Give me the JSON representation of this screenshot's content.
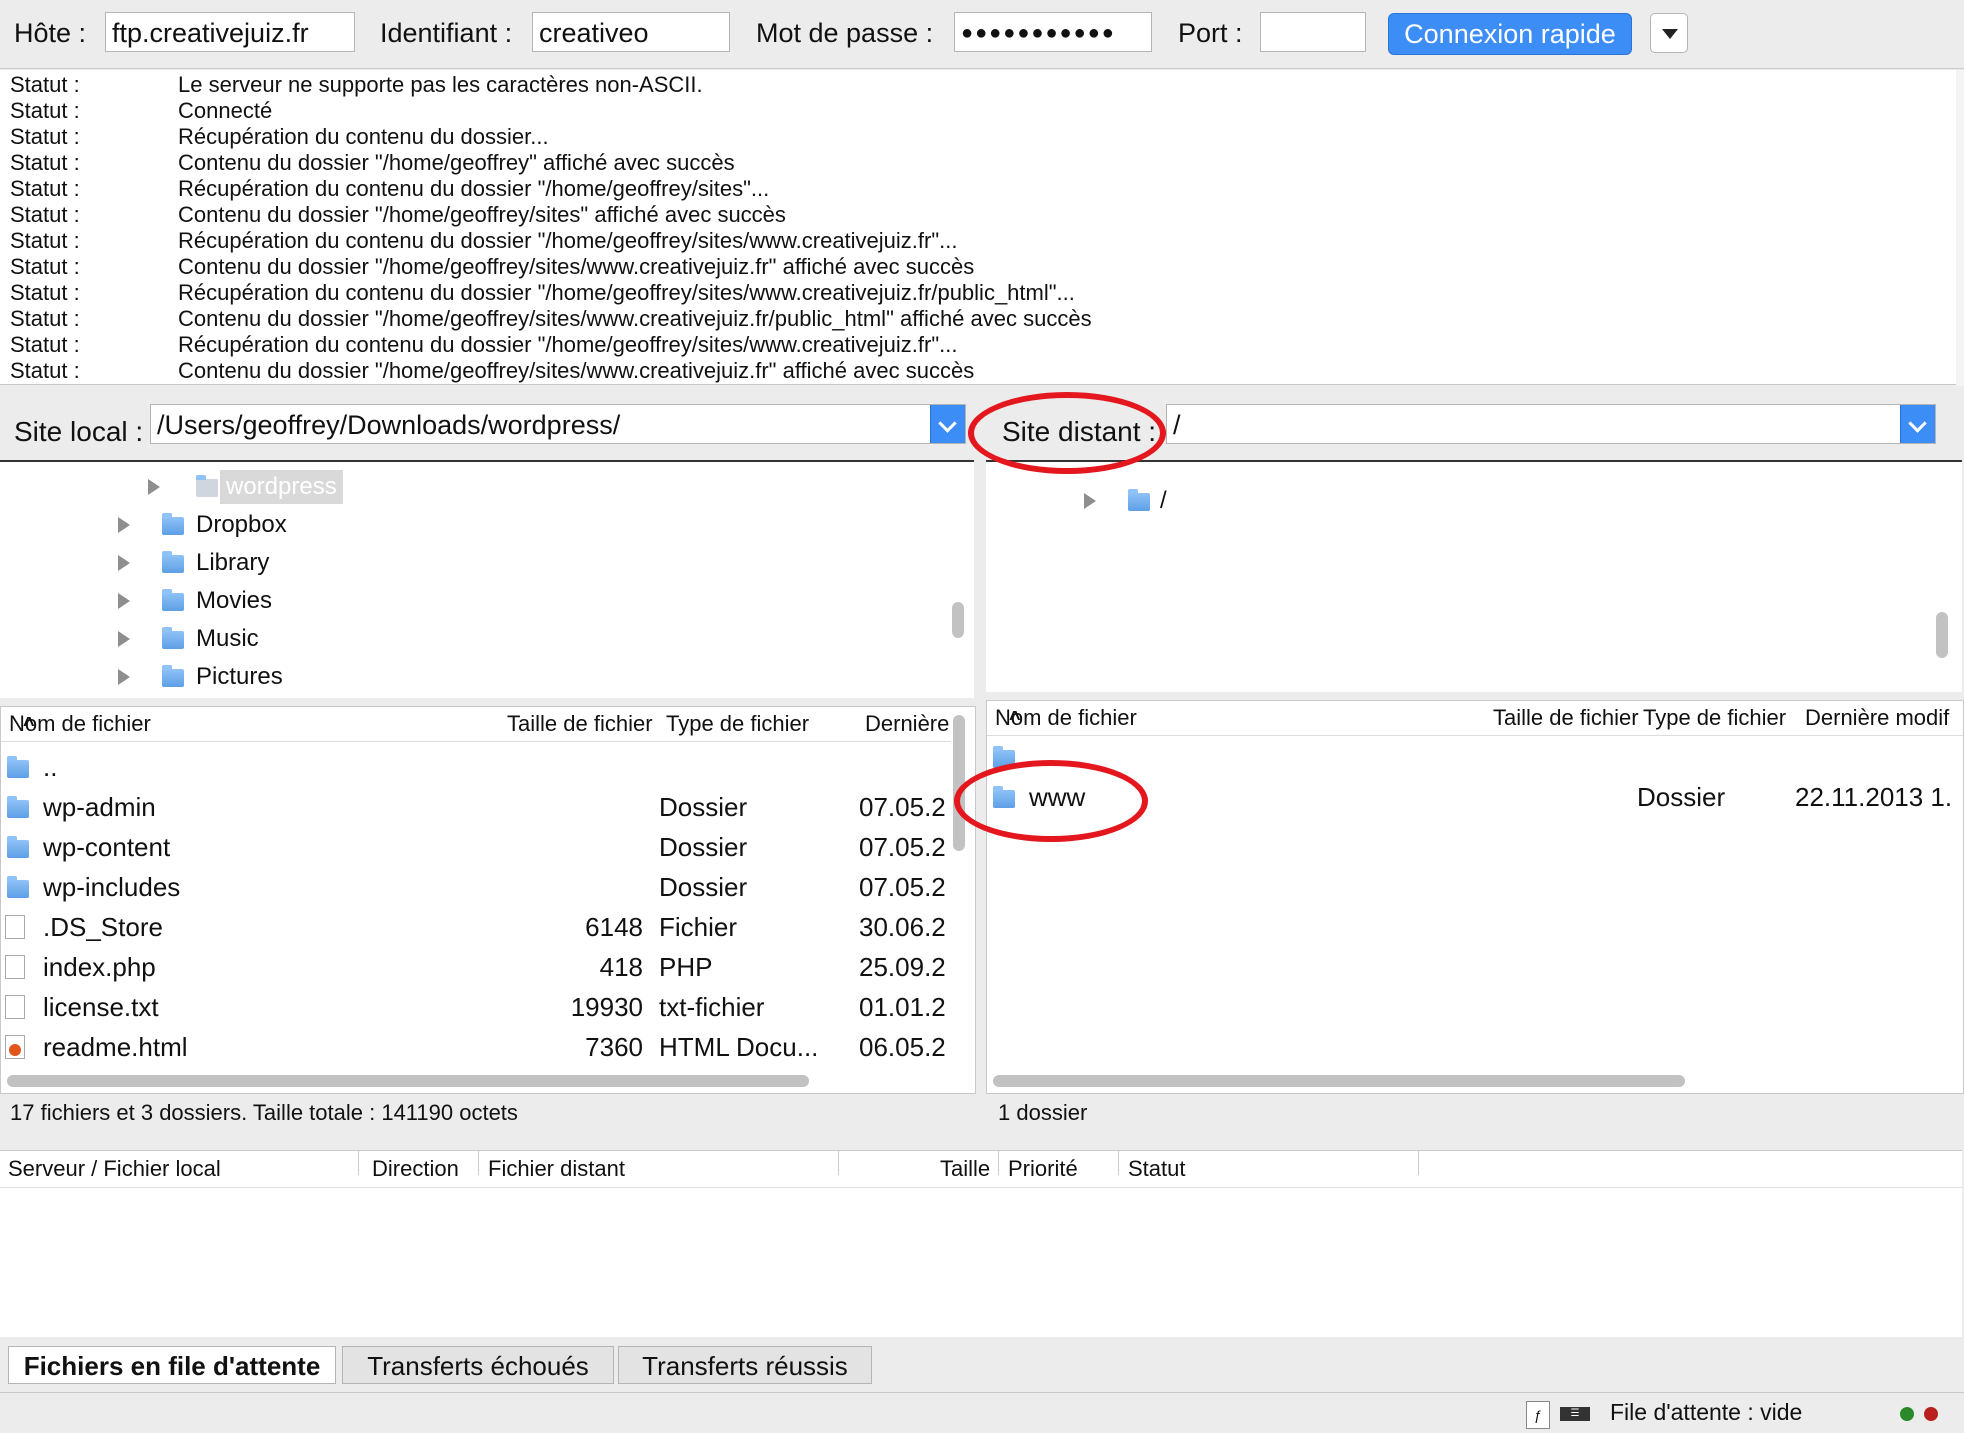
{
  "quickconnect": {
    "host_label": "Hôte :",
    "host_value": "ftp.creativejuiz.fr",
    "user_label": "Identifiant :",
    "user_value": "creativeo",
    "pass_label": "Mot de passe :",
    "pass_value": "●●●●●●●●●●●",
    "port_label": "Port :",
    "port_value": "",
    "connect_label": "Connexion rapide",
    "accent": "#3c8df6"
  },
  "log": [
    {
      "k": "Statut :",
      "v": "Le serveur ne supporte pas les caractères non-ASCII."
    },
    {
      "k": "Statut :",
      "v": "Connecté"
    },
    {
      "k": "Statut :",
      "v": "Récupération du contenu du dossier..."
    },
    {
      "k": "Statut :",
      "v": "Contenu du dossier \"/home/geoffrey\" affiché avec succès"
    },
    {
      "k": "Statut :",
      "v": "Récupération du contenu du dossier \"/home/geoffrey/sites\"..."
    },
    {
      "k": "Statut :",
      "v": "Contenu du dossier \"/home/geoffrey/sites\" affiché avec succès"
    },
    {
      "k": "Statut :",
      "v": "Récupération du contenu du dossier \"/home/geoffrey/sites/www.creativejuiz.fr\"..."
    },
    {
      "k": "Statut :",
      "v": "Contenu du dossier \"/home/geoffrey/sites/www.creativejuiz.fr\" affiché avec succès"
    },
    {
      "k": "Statut :",
      "v": "Récupération du contenu du dossier \"/home/geoffrey/sites/www.creativejuiz.fr/public_html\"..."
    },
    {
      "k": "Statut :",
      "v": "Contenu du dossier \"/home/geoffrey/sites/www.creativejuiz.fr/public_html\" affiché avec succès"
    },
    {
      "k": "Statut :",
      "v": "Récupération du contenu du dossier \"/home/geoffrey/sites/www.creativejuiz.fr\"..."
    },
    {
      "k": "Statut :",
      "v": "Contenu du dossier \"/home/geoffrey/sites/www.creativejuiz.fr\" affiché avec succès"
    }
  ],
  "local": {
    "label": "Site local :",
    "path": "/Users/geoffrey/Downloads/wordpress/",
    "tree": [
      "wordpress",
      "Dropbox",
      "Library",
      "Movies",
      "Music",
      "Pictures"
    ],
    "columns": {
      "name": "Nom de fichier",
      "size": "Taille de fichier",
      "type": "Type de fichier",
      "date": "Dernière"
    },
    "files": [
      {
        "name": "..",
        "size": "",
        "type": "",
        "date": "",
        "icon": "folder-icon"
      },
      {
        "name": "wp-admin",
        "size": "",
        "type": "Dossier",
        "date": "07.05.2",
        "icon": "folder-icon"
      },
      {
        "name": "wp-content",
        "size": "",
        "type": "Dossier",
        "date": "07.05.2",
        "icon": "folder-icon"
      },
      {
        "name": "wp-includes",
        "size": "",
        "type": "Dossier",
        "date": "07.05.2",
        "icon": "folder-icon"
      },
      {
        "name": ".DS_Store",
        "size": "6148",
        "type": "Fichier",
        "date": "30.06.2",
        "icon": "file-icon"
      },
      {
        "name": "index.php",
        "size": "418",
        "type": "PHP",
        "date": "25.09.2",
        "icon": "file-icon"
      },
      {
        "name": "license.txt",
        "size": "19930",
        "type": "txt-fichier",
        "date": "01.01.2",
        "icon": "file-icon"
      },
      {
        "name": "readme.html",
        "size": "7360",
        "type": "HTML Docu...",
        "date": "06.05.2",
        "icon": "html-file-icon"
      }
    ],
    "status": "17 fichiers et 3 dossiers. Taille totale : 141190 octets"
  },
  "remote": {
    "label": "Site distant :",
    "path": "/",
    "tree": [
      "/"
    ],
    "columns": {
      "name": "Nom de fichier",
      "size": "Taille de fichier",
      "type": "Type de fichier",
      "date": "Dernière modif"
    },
    "files": [
      {
        "name": "",
        "size": "",
        "type": "",
        "date": "",
        "icon": "folder-icon"
      },
      {
        "name": "www",
        "size": "",
        "type": "Dossier",
        "date": "22.11.2013 1.",
        "icon": "folder-icon"
      }
    ],
    "status": "1 dossier"
  },
  "queue": {
    "columns": [
      "Serveur / Fichier local",
      "Direction",
      "Fichier distant",
      "Taille",
      "Priorité",
      "Statut"
    ],
    "tabs": [
      "Fichiers en file d'attente",
      "Transferts échoués",
      "Transferts réussis"
    ],
    "status": "File d'attente : vide"
  },
  "annotation_color": "#e3171d"
}
